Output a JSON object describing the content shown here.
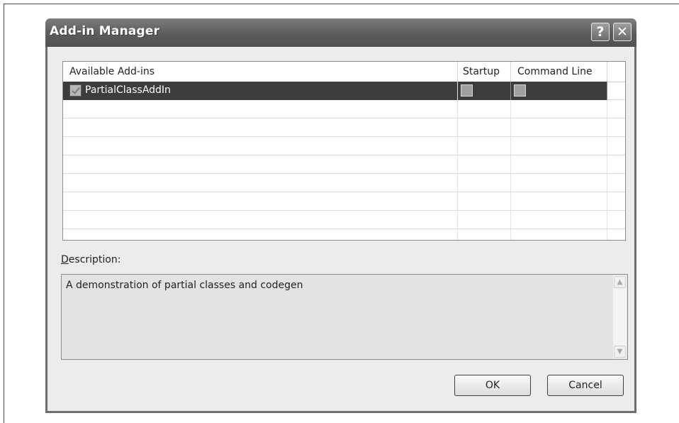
{
  "window": {
    "title": "Add-in Manager",
    "help_glyph": "?",
    "close_glyph": "✕"
  },
  "addins_list": {
    "columns": [
      "Available Add-ins",
      "Startup",
      "Command Line"
    ],
    "rows": [
      {
        "name": "PartialClassAddIn",
        "checked": true,
        "startup": false,
        "command_line": false,
        "selected": true
      }
    ],
    "empty_row_count": 8
  },
  "description": {
    "label_mnemonic": "D",
    "label_rest": "escription:",
    "text": "A demonstration of partial classes and codegen"
  },
  "buttons": {
    "ok": "OK",
    "cancel": "Cancel"
  },
  "colors": {
    "selection": "#3c3c3c",
    "titlebar": "#5c5c5c"
  }
}
